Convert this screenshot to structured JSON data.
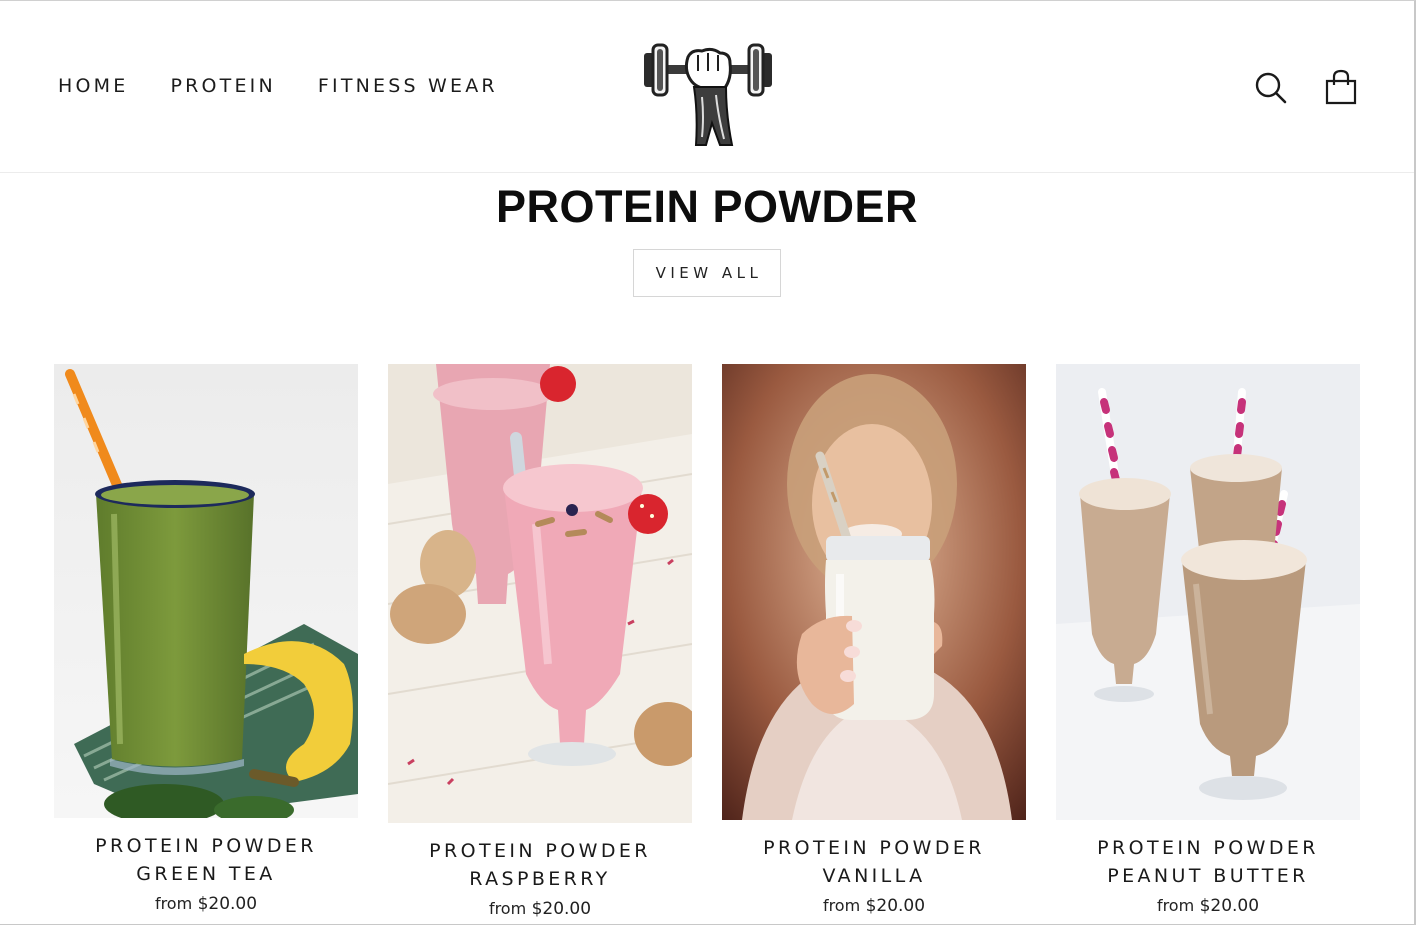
{
  "nav": {
    "items": [
      {
        "label": "HOME"
      },
      {
        "label": "PROTEIN"
      },
      {
        "label": "FITNESS WEAR"
      }
    ]
  },
  "header": {
    "logo_icon": "flexed-arm-dumbbell-logo",
    "search_icon": "search-icon",
    "cart_icon": "shopping-bag-icon"
  },
  "section": {
    "title": "PROTEIN POWDER",
    "view_all_label": "VIEW ALL"
  },
  "products": [
    {
      "name": "PROTEIN POWDER GREEN TEA",
      "price_prefix": "from",
      "price": "$20.00",
      "image": "green smoothie glass with orange straw and banana"
    },
    {
      "name": "PROTEIN POWDER RASPBERRY",
      "price_prefix": "from",
      "price": "$20.00",
      "image": "pink raspberry shakes with strawberries and cookies"
    },
    {
      "name": "PROTEIN POWDER VANILLA",
      "price_prefix": "from",
      "price": "$20.00",
      "image": "woman holding vanilla shake in jar"
    },
    {
      "name": "PROTEIN POWDER PEANUT BUTTER",
      "price_prefix": "from",
      "price": "$20.00",
      "image": "three peanut butter shakes with striped straws"
    }
  ],
  "colors": {
    "text": "#111111",
    "border": "#d6d6d6",
    "background": "#ffffff"
  }
}
